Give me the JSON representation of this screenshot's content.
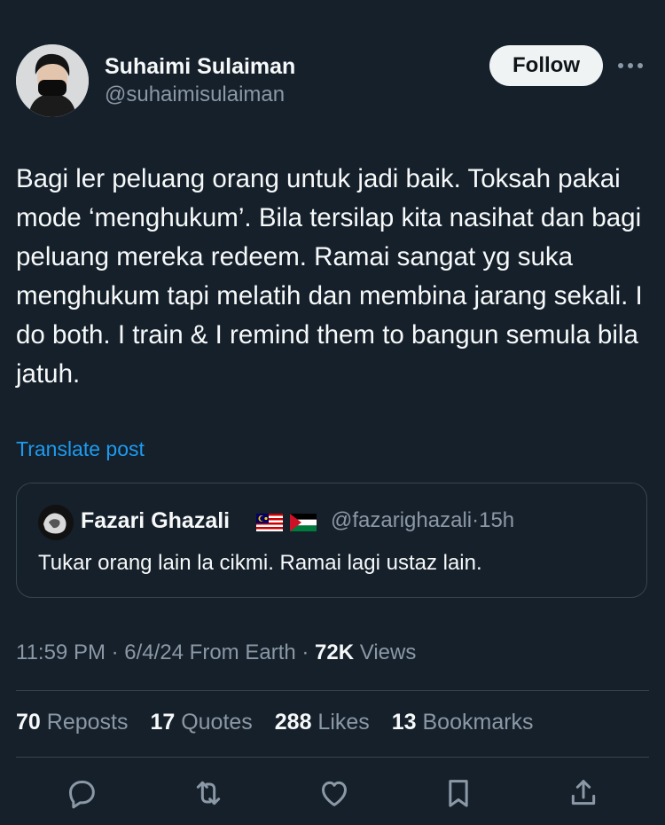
{
  "author": {
    "display_name": "Suhaimi Sulaiman",
    "handle": "@suhaimisulaiman",
    "follow_label": "Follow"
  },
  "tweet": {
    "text": "Bagi ler peluang orang untuk jadi baik.  Toksah pakai mode ‘menghukum’.  Bila tersilap kita nasihat dan bagi peluang mereka redeem.  Ramai sangat yg suka menghukum tapi melatih dan membina jarang sekali.  I do both.  I train & I remind them to bangun semula bila jatuh.",
    "translate_label": "Translate post"
  },
  "quote": {
    "display_name": "Fazari Ghazali",
    "handle": "@fazarighazali",
    "separator": "·",
    "time": "15h",
    "text": "Tukar orang lain la cikmi. Ramai lagi ustaz lain."
  },
  "meta": {
    "time": "11:59 PM",
    "sep1": " · ",
    "date": "6/4/24",
    "location": " From Earth",
    "sep2": " · ",
    "views_count": "72K",
    "views_label": " Views"
  },
  "stats": {
    "reposts_count": "70",
    "reposts_label": " Reposts",
    "quotes_count": "17",
    "quotes_label": " Quotes",
    "likes_count": "288",
    "likes_label": " Likes",
    "bookmarks_count": "13",
    "bookmarks_label": " Bookmarks"
  },
  "icons": {
    "more": "more-horizontal-icon",
    "reply": "reply-icon",
    "repost": "repost-icon",
    "like": "heart-icon",
    "bookmark": "bookmark-icon",
    "share": "share-icon"
  },
  "colors": {
    "background": "#15202b",
    "text": "#f7f9f9",
    "secondary": "#8b98a5",
    "link": "#1d9bf0",
    "border": "#38444d"
  }
}
